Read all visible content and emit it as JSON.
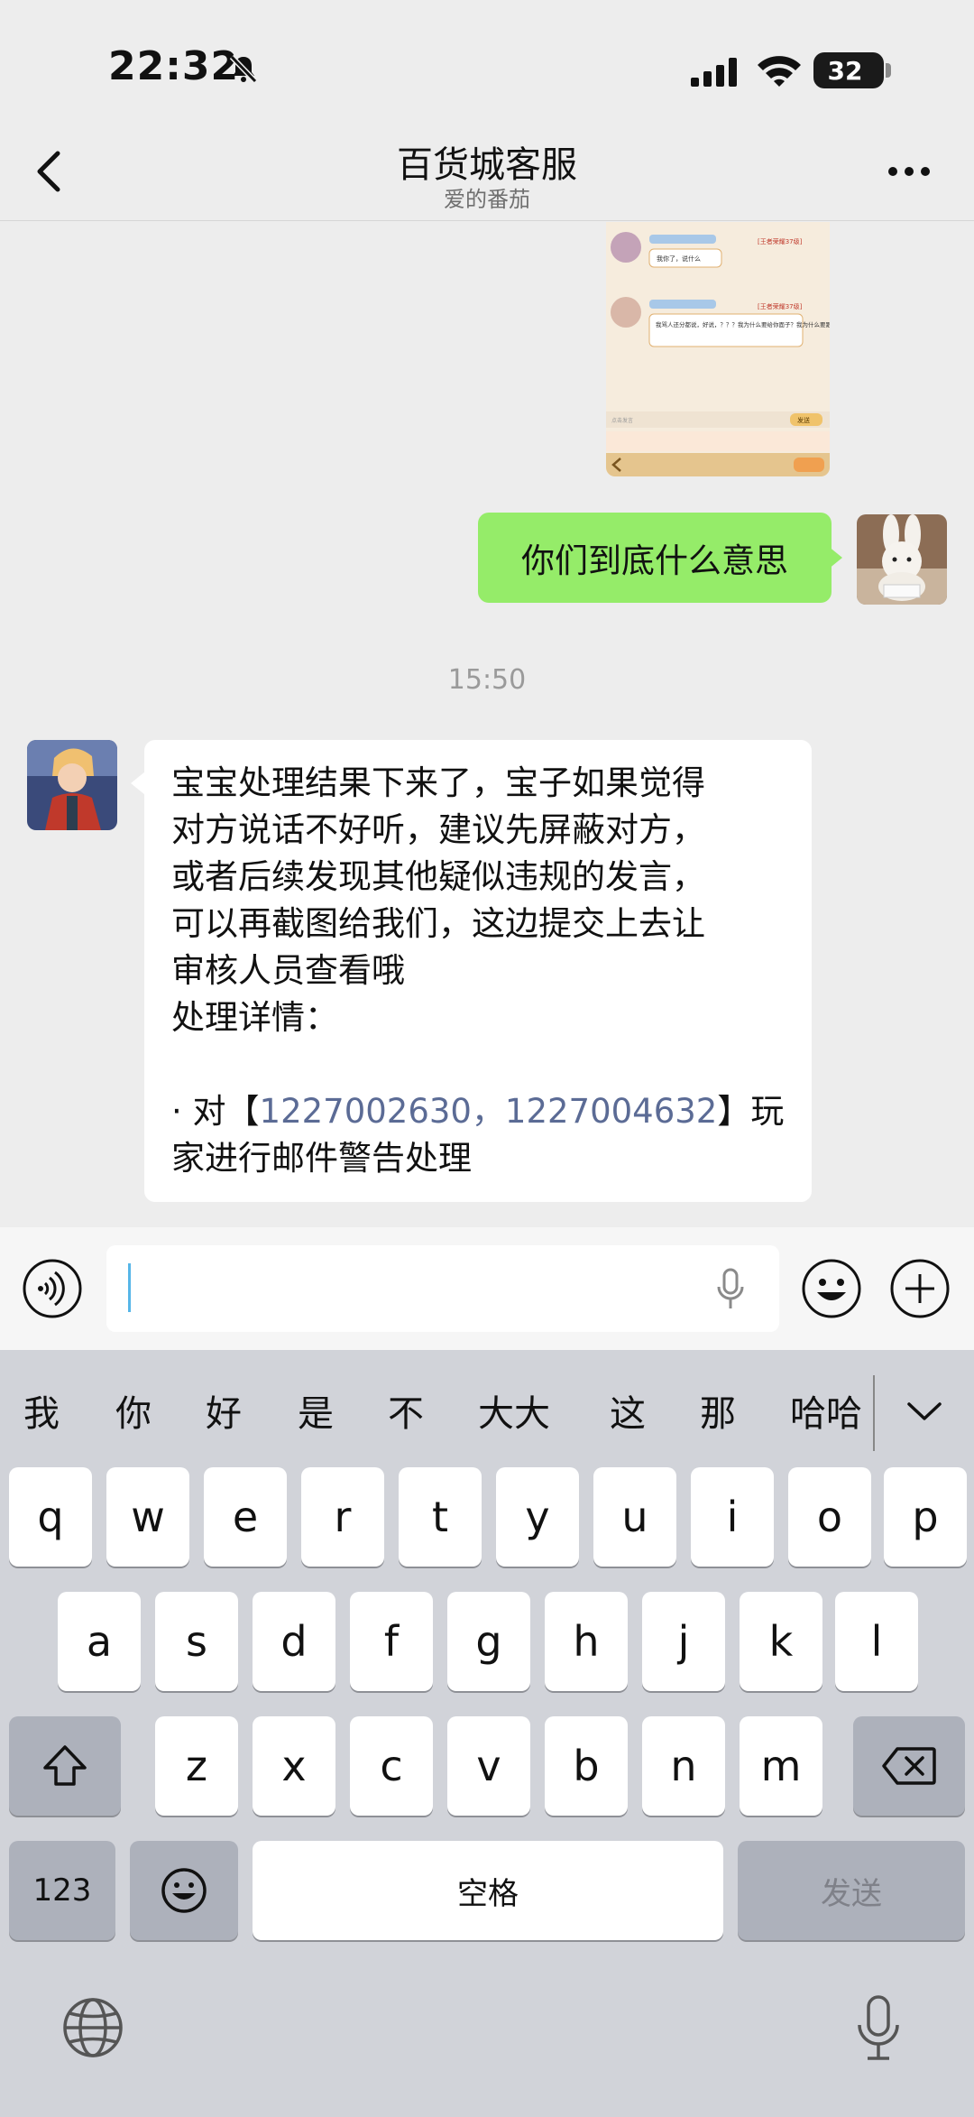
{
  "status_bar": {
    "time": "22:32",
    "battery": "32"
  },
  "nav": {
    "title": "百货城客服",
    "subtitle": "爱的番茄"
  },
  "chat": {
    "my_message": "你们到底什么意思",
    "timestamp": "15:50",
    "agent_lines": [
      "宝宝处理结果下来了，宝子如果觉得",
      "对方说话不好听，建议先屏蔽对方，",
      "或者后续发现其他疑似违规的发言，",
      "可以再截图给我们，这边提交上去让",
      "审核人员查看哦",
      "处理详情："
    ],
    "detail_prefix": "· 对【",
    "detail_ids": "1227002630，1227004632",
    "detail_suffix": "】玩",
    "detail_line2": "家进行邮件警告处理",
    "screenshot": {
      "tag1": "[王者荣耀37级]",
      "msg1": "我你了，说什么",
      "tag2": "[王者荣耀37级]",
      "msg2": "我骂人还分都说，好说，？？？我为什么要给你面子？我为什么要跟你讲素质？",
      "input_placeholder": "点击发言",
      "send": "发送"
    }
  },
  "keyboard": {
    "candidates": [
      "我",
      "你",
      "好",
      "是",
      "不",
      "大大",
      "这",
      "那",
      "哈哈"
    ],
    "row1": [
      "q",
      "w",
      "e",
      "r",
      "t",
      "y",
      "u",
      "i",
      "o",
      "p"
    ],
    "row2": [
      "a",
      "s",
      "d",
      "f",
      "g",
      "h",
      "j",
      "k",
      "l"
    ],
    "row3": [
      "z",
      "x",
      "c",
      "v",
      "b",
      "n",
      "m"
    ],
    "numbers_key": "123",
    "space_key": "空格",
    "send_key": "发送"
  },
  "icons": {
    "back": "chevron-left-icon",
    "more": "ellipsis-icon",
    "voice": "voice-icon",
    "emoji": "emoji-icon",
    "plus": "plus-icon",
    "shift": "shift-icon",
    "delete": "backspace-icon",
    "globe": "globe-icon",
    "dictation": "microphone-icon"
  },
  "colors": {
    "my_bubble": "#95ec69",
    "link_ids": "#5b6b95",
    "chat_bg": "#ededed"
  }
}
